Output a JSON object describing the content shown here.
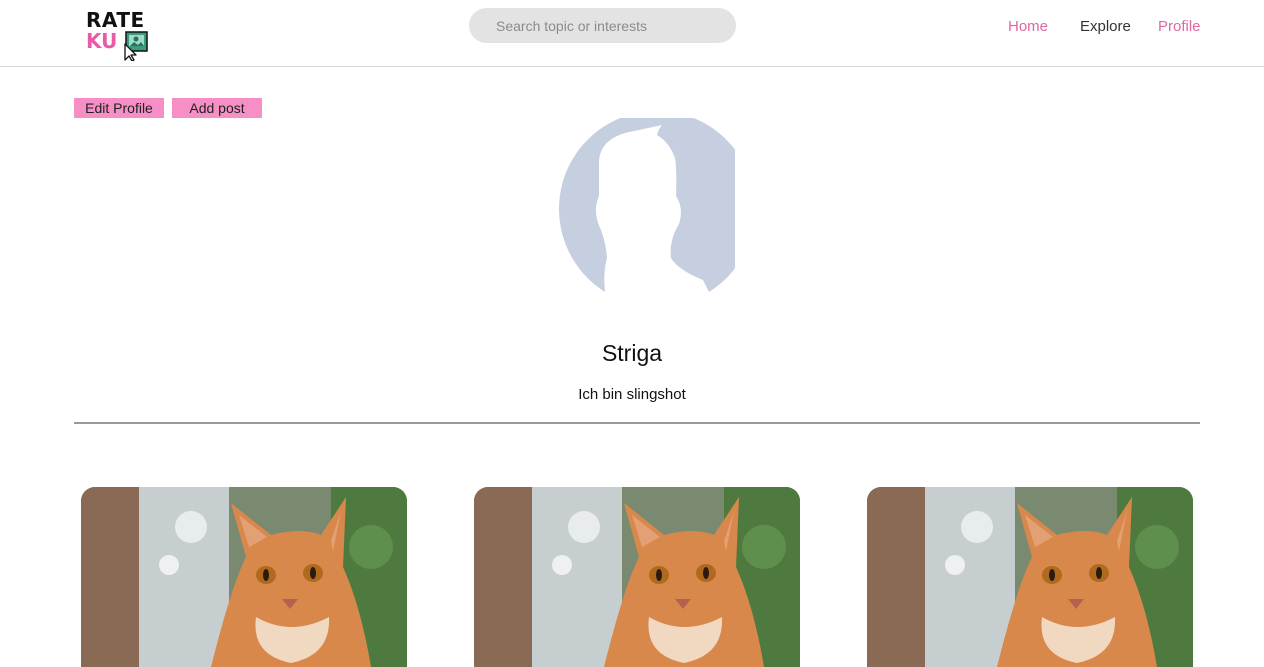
{
  "header": {
    "logo_line1": "RATE",
    "logo_line2": "KU",
    "search_placeholder": "Search topic or interests",
    "nav": {
      "home": "Home",
      "explore": "Explore",
      "profile": "Profile"
    }
  },
  "actions": {
    "edit_profile": "Edit Profile",
    "add_post": "Add post"
  },
  "profile": {
    "username": "Striga",
    "bio": "Ich bin slingshot",
    "avatar_icon": "default-user-silhouette-icon"
  },
  "posts": [
    {
      "image": "orange-tabby-cat-photo"
    },
    {
      "image": "orange-tabby-cat-photo"
    },
    {
      "image": "orange-tabby-cat-photo"
    }
  ],
  "colors": {
    "accent_pink": "#e0679f",
    "button_pink": "#f58fc6",
    "avatar_blue": "#c5cfdf",
    "search_bg": "#e3e3e3"
  }
}
